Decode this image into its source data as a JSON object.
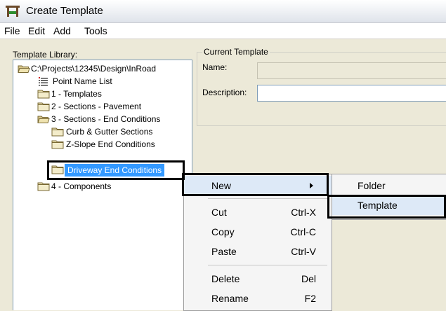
{
  "window": {
    "title": "Create Template"
  },
  "menubar": [
    {
      "label": "File"
    },
    {
      "label": "Edit"
    },
    {
      "label": "Add"
    },
    {
      "label": "Tools"
    }
  ],
  "library": {
    "label": "Template Library:",
    "root": "C:\\Projects\\12345\\Design\\InRoad",
    "items": [
      {
        "label": "Point Name List"
      },
      {
        "label": "1 - Templates"
      },
      {
        "label": "2 - Sections - Pavement"
      },
      {
        "label": "3 - Sections - End Conditions"
      },
      {
        "label": "Curb & Gutter Sections"
      },
      {
        "label": "Z-Slope End Conditions"
      },
      {
        "label": "Driveway End Conditions"
      },
      {
        "label": "4 - Components"
      }
    ]
  },
  "current_template": {
    "legend": "Current Template",
    "name_label": "Name:",
    "name_value": "",
    "description_label": "Description:",
    "description_value": ""
  },
  "context_menu": [
    {
      "label": "New",
      "shortcut": ""
    },
    {
      "label": "Cut",
      "shortcut": "Ctrl-X"
    },
    {
      "label": "Copy",
      "shortcut": "Ctrl-C"
    },
    {
      "label": "Paste",
      "shortcut": "Ctrl-V"
    },
    {
      "label": "Delete",
      "shortcut": "Del"
    },
    {
      "label": "Rename",
      "shortcut": "F2"
    }
  ],
  "submenu": [
    {
      "label": "Folder"
    },
    {
      "label": "Template"
    }
  ],
  "colors": {
    "selection": "#3399ff",
    "highlight_border": "#000000",
    "menu_hover": "#dde9f7"
  }
}
